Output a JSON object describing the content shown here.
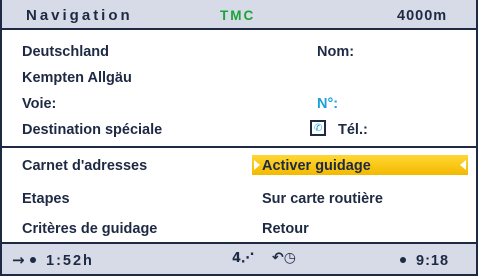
{
  "header": {
    "title": "Navigation",
    "tmc": "TMC",
    "distance": "4000m"
  },
  "location": {
    "country": "Deutschland",
    "city": "Kempten Allgäu",
    "street_label": "Voie:",
    "special_destination": "Destination spéciale",
    "name_label": "Nom:",
    "number_label": "N°:",
    "phone_label": "Tél.:"
  },
  "menu": {
    "left": [
      "Carnet d'adresses",
      "Etapes",
      "Critères de guidage"
    ],
    "right": [
      "Activer guidage",
      "Sur carte routière",
      "Retour"
    ],
    "selected_index": 0
  },
  "status": {
    "travel_time": "1:52h",
    "clock": "9:18"
  },
  "icons": {
    "route_icon": "arrow-right-dot",
    "signal_icon": "gps-signal",
    "reroute_icon": "reroute-clock",
    "phone_icon": "phone-handset"
  },
  "colors": {
    "navy": "#1e2a44",
    "tmc_green": "#1aa43a",
    "accent_blue": "#1aa0de",
    "highlight": "#f3b900",
    "bar_bg": "#d7dbe7"
  }
}
